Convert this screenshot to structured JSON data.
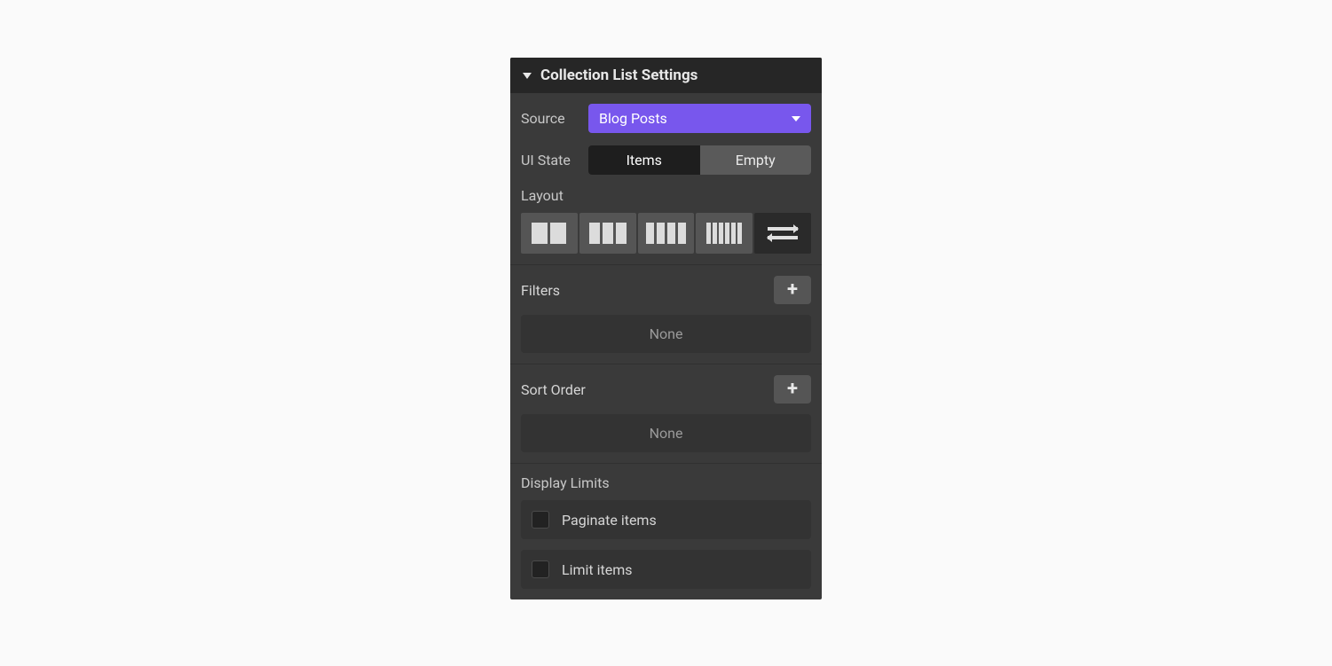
{
  "panel": {
    "title": "Collection List Settings"
  },
  "source": {
    "label": "Source",
    "value": "Blog Posts"
  },
  "uistate": {
    "label": "UI State",
    "options": [
      "Items",
      "Empty"
    ],
    "active": "Items"
  },
  "layout": {
    "label": "Layout"
  },
  "filters": {
    "label": "Filters",
    "empty": "None"
  },
  "sort": {
    "label": "Sort Order",
    "empty": "None"
  },
  "limits": {
    "label": "Display Limits",
    "paginate": "Paginate items",
    "limit": "Limit items"
  }
}
